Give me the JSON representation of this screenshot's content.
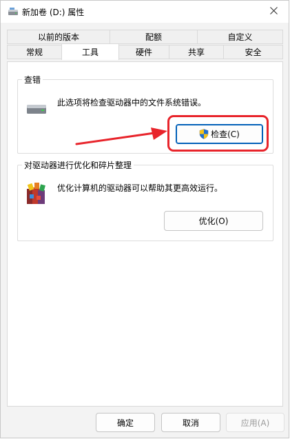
{
  "window": {
    "title": "新加卷 (D:) 属性",
    "icon": "drive-icon",
    "close_icon": "close-icon"
  },
  "tabs_row1": [
    {
      "label": "以前的版本"
    },
    {
      "label": "配额"
    },
    {
      "label": "自定义"
    }
  ],
  "tabs_row2": [
    {
      "label": "常规"
    },
    {
      "label": "工具",
      "active": true
    },
    {
      "label": "硬件"
    },
    {
      "label": "共享"
    },
    {
      "label": "安全"
    }
  ],
  "error_check": {
    "title": "查错",
    "description": "此选项将检查驱动器中的文件系统错误。",
    "button_label": "检查(C)",
    "button_icon": "uac-shield-icon",
    "annotation_color": "#e8242b"
  },
  "optimize": {
    "title": "对驱动器进行优化和碎片整理",
    "description": "优化计算机的驱动器可以帮助其更高效运行。",
    "button_label": "优化(O)",
    "icon": "defrag-icon"
  },
  "footer": {
    "ok_label": "确定",
    "cancel_label": "取消",
    "apply_label": "应用(A)"
  },
  "colors": {
    "accent": "#005fb8",
    "annotation_red": "#e8242b"
  }
}
